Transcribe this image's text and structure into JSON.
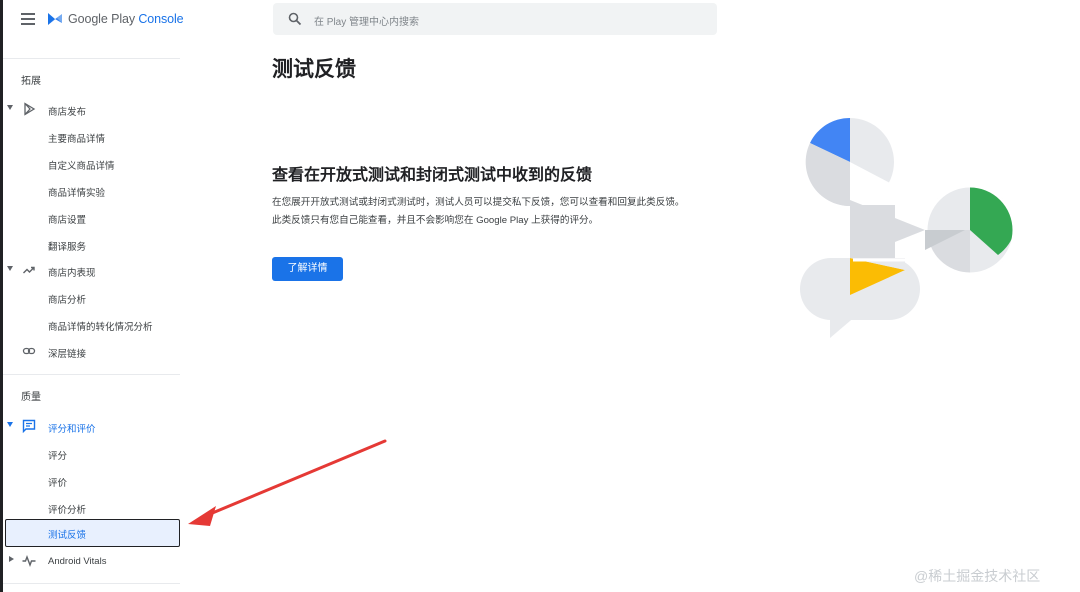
{
  "brand": {
    "name_part1": "Google Play",
    "name_part2": "Console"
  },
  "search": {
    "placeholder": "在 Play 管理中心内搜索"
  },
  "sidebar": {
    "section1_title": "拓展",
    "store_presence": {
      "label": "商店发布",
      "items": [
        "主要商品详情",
        "自定义商品详情",
        "商品详情实验",
        "商店设置",
        "翻译服务"
      ]
    },
    "store_performance": {
      "label": "商店内表现",
      "items": [
        "商店分析",
        "商品详情的转化情况分析"
      ]
    },
    "deep_links": {
      "label": "深层链接"
    },
    "section2_title": "质量",
    "ratings_reviews": {
      "label": "评分和评价",
      "items": [
        "评分",
        "评价",
        "评价分析",
        "测试反馈"
      ],
      "active_index": 3
    },
    "android_vitals": {
      "label": "Android Vitals"
    }
  },
  "main": {
    "title": "测试反馈",
    "headline": "查看在开放式测试和封闭式测试中收到的反馈",
    "description": "在您展开开放式测试或封闭式测试时，测试人员可以提交私下反馈，您可以查看和回复此类反馈。此类反馈只有您自己能查看，并且不会影响您在 Google Play 上获得的评分。",
    "learn_more_button": "了解详情"
  },
  "watermark": "@稀土掘金技术社区",
  "colors": {
    "accent": "#1a73e8",
    "annotation_arrow": "#e53935",
    "illustration_blue": "#4285f4",
    "illustration_green": "#34a853",
    "illustration_yellow": "#fbbc04"
  }
}
